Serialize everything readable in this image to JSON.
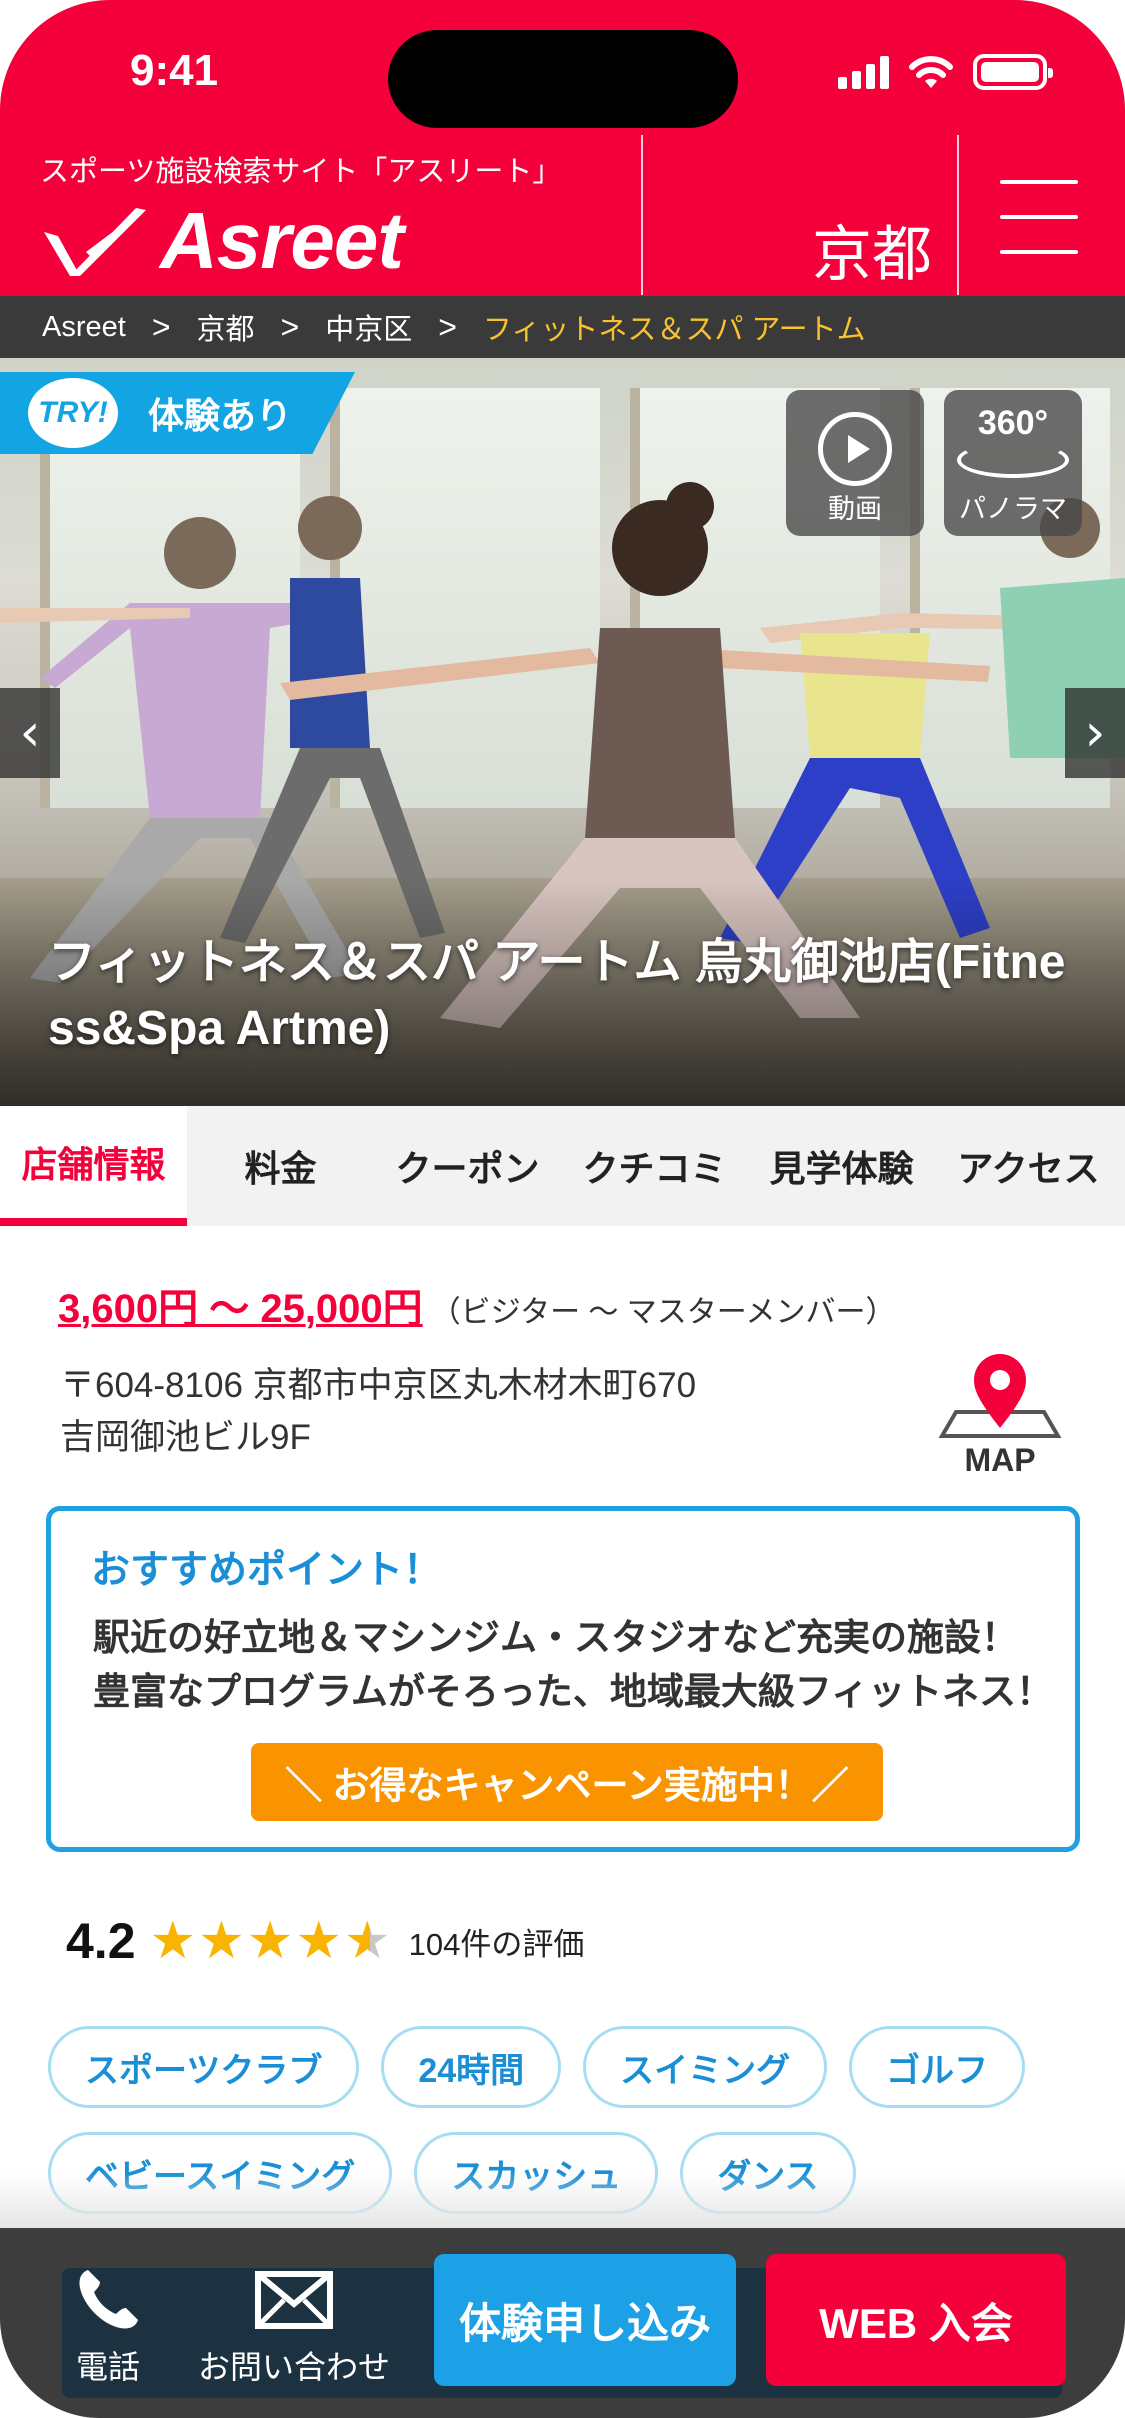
{
  "status_bar": {
    "time": "9:41"
  },
  "header": {
    "tagline": "スポーツ施設検索サイト「アスリート」",
    "logo_text": "Asreet",
    "area": "京都"
  },
  "breadcrumb": {
    "items": [
      "Asreet",
      "京都",
      "中京区"
    ],
    "current": "フィットネス＆スパ アートム",
    "separator": ">"
  },
  "hero": {
    "try_badge_circle": "TRY!",
    "try_badge_label": "体験あり",
    "video_label": "動画",
    "panorama_top": "360°",
    "panorama_label": "パノラマ",
    "prev_arrow": "‹",
    "next_arrow": "›",
    "title": "フィットネス＆スパ アートム 烏丸御池店(Fitness&Spa Artme)"
  },
  "tabs": [
    "店舗情報",
    "料金",
    "クーポン",
    "クチコミ",
    "見学体験",
    "アクセス"
  ],
  "info": {
    "price": "3,600円 〜 25,000円",
    "price_note": "（ビジター 〜 マスターメンバー）",
    "address_line1": "〒604-8106 京都市中京区丸木材木町670",
    "address_line2": "吉岡御池ビル9F",
    "map_label": "MAP"
  },
  "recommend": {
    "title": "おすすめポイント！",
    "line1": "駅近の好立地＆マシンジム・スタジオなど充実の施設！",
    "line2": "豊富なプログラムがそろった、地域最大級フィットネス！",
    "campaign": "＼ お得なキャンペーン実施中！／"
  },
  "rating": {
    "score": "4.2",
    "value": 4.2,
    "max": 5,
    "count": "104件の評価"
  },
  "tags": [
    "スポーツクラブ",
    "24時間",
    "スイミング",
    "ゴルフ",
    "ベビースイミング",
    "スカッシュ",
    "ダンス"
  ],
  "bottom_bar": {
    "phone_label": "電話",
    "contact_label": "お問い合わせ",
    "trial_button": "体験申し込み",
    "web_button": "WEB 入会"
  },
  "colors": {
    "brand_red": "#f4003a",
    "accent_blue": "#1da1e6",
    "campaign_orange": "#f99400",
    "breadcrumb_current": "#f7c12f"
  }
}
